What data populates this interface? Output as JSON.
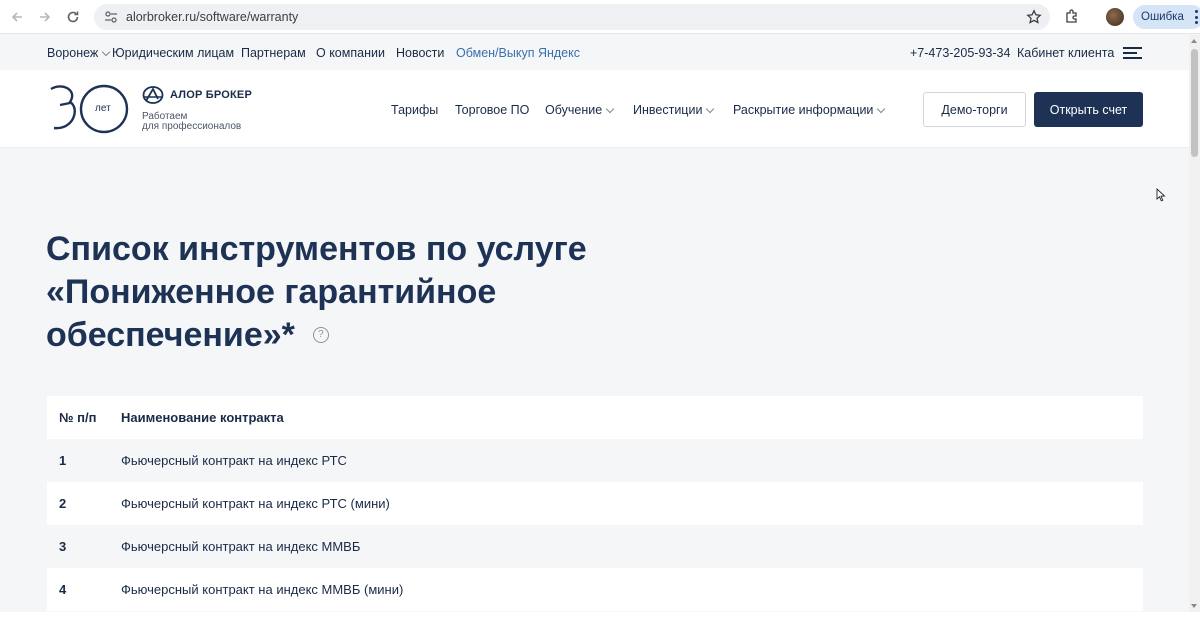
{
  "browser": {
    "url": "alorbroker.ru/software/warranty",
    "profile_status": "Ошибка"
  },
  "util_bar": {
    "city": "Воронеж",
    "links": [
      "Юридическим лицам",
      "Партнерам",
      "О компании",
      "Новости"
    ],
    "accent_link": "Обмен/Выкуп Яндекс",
    "phone": "+7-473-205-93-34",
    "cabinet": "Кабинет клиента"
  },
  "logo": {
    "years_number": "30",
    "years_label": "лет",
    "brand": "АЛОР БРОКЕР",
    "tagline_line1": "Работаем",
    "tagline_line2": "для профессионалов"
  },
  "main_nav": {
    "items": [
      "Тарифы",
      "Торговое ПО",
      "Обучение",
      "Инвестиции",
      "Раскрытие информации"
    ],
    "demo_button": "Демо-торги",
    "open_button": "Открыть счет"
  },
  "page": {
    "title": "Список инструментов по услуге «Пониженное гарантийное обеспечение»*",
    "help_glyph": "?"
  },
  "table": {
    "columns": [
      "№ п/п",
      "Наименование контракта"
    ],
    "rows": [
      [
        "1",
        "Фьючерсный контракт на индекс РТС"
      ],
      [
        "2",
        "Фьючерсный контракт на индекс РТС (мини)"
      ],
      [
        "3",
        "Фьючерсный контракт на индекс ММВБ"
      ],
      [
        "4",
        "Фьючерсный контракт на индекс ММВБ (мини)"
      ]
    ]
  },
  "colors": {
    "brand_navy": "#1d3255",
    "accent_link": "#3a6fb0",
    "page_bg": "#f5f6f7"
  }
}
